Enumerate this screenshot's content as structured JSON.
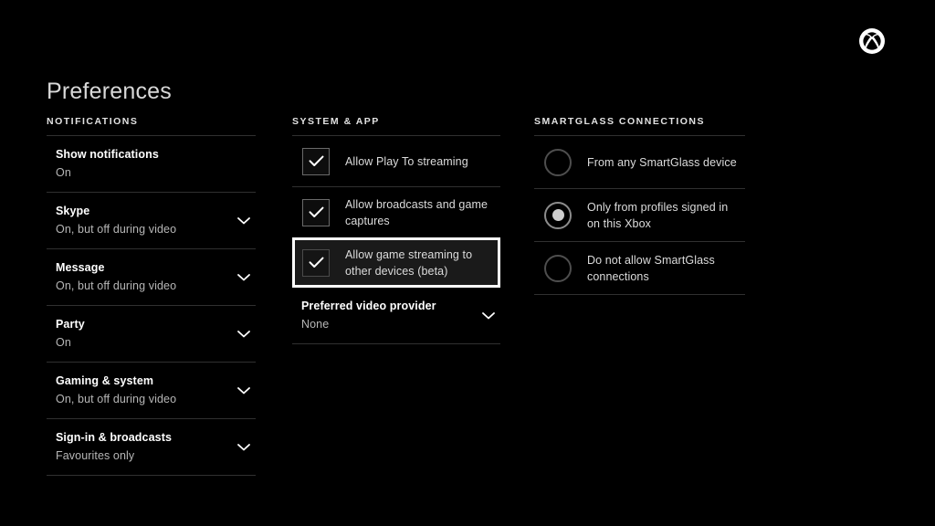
{
  "brand": {
    "logo_icon": "xbox-logo-icon",
    "accent_color": "#107c10",
    "background_color": "#000000",
    "focus_border_color": "#ffffff",
    "focus_fill_color": "#1a1a1a"
  },
  "page_title": "Preferences",
  "columns": {
    "notifications": {
      "header": "NOTIFICATIONS",
      "items": [
        {
          "title": "Show notifications",
          "value": "On",
          "chevron": false
        },
        {
          "title": "Skype",
          "value": "On, but off during video",
          "chevron": true
        },
        {
          "title": "Message",
          "value": "On, but off during video",
          "chevron": true
        },
        {
          "title": "Party",
          "value": "On",
          "chevron": true
        },
        {
          "title": "Gaming & system",
          "value": "On, but off during video",
          "chevron": true
        },
        {
          "title": "Sign-in & broadcasts",
          "value": "Favourites only",
          "chevron": true
        }
      ]
    },
    "system_app": {
      "header": "SYSTEM & APP",
      "checkboxes": [
        {
          "label": "Allow Play To streaming",
          "checked": true,
          "focused": false
        },
        {
          "label": "Allow broadcasts and game captures",
          "checked": true,
          "focused": false
        },
        {
          "label": "Allow game streaming to other devices (beta)",
          "checked": true,
          "focused": true
        }
      ],
      "dropdown": {
        "title": "Preferred video provider",
        "value": "None",
        "chevron": true
      }
    },
    "smartglass": {
      "header": "SMARTGLASS CONNECTIONS",
      "options": [
        {
          "label": "From any SmartGlass device",
          "selected": false
        },
        {
          "label": "Only from profiles signed in on this Xbox",
          "selected": true
        },
        {
          "label": "Do not allow SmartGlass connections",
          "selected": false
        }
      ]
    }
  }
}
